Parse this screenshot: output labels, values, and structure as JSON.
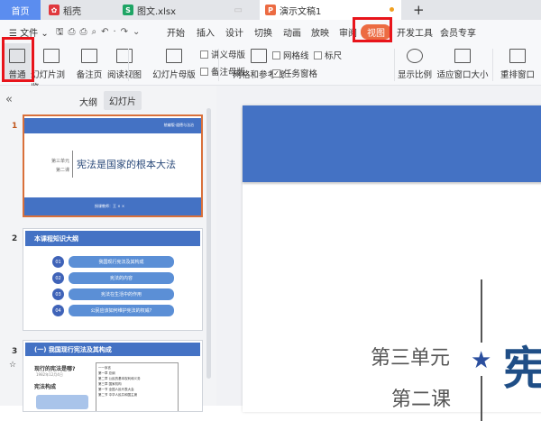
{
  "tabs": [
    {
      "label": "首页"
    },
    {
      "label": "稻壳"
    },
    {
      "label": "图文.xlsx"
    },
    {
      "label": "演示文稿1"
    }
  ],
  "new_tab": "+",
  "menu": {
    "file": "文件",
    "items": [
      "开始",
      "插入",
      "设计",
      "切换",
      "动画",
      "放映",
      "审阅",
      "视图",
      "开发工具",
      "会员专享"
    ]
  },
  "ribbon": {
    "normal": "普通",
    "slide_sorter": "幻灯片浏览",
    "notes_page": "备注页",
    "reading_view": "阅读视图",
    "slide_master": "幻灯片母版",
    "handout_master": "讲义母版",
    "notes_master": "备注母版",
    "grid_guides": "网格和参考线",
    "gridlines": "网格线",
    "ruler": "标尺",
    "task_pane": "任务窗格",
    "zoom": "显示比例",
    "fit_window": "适应窗口大小",
    "arrange": "重排窗口"
  },
  "panel": {
    "collapse": "«",
    "tab_outline": "大纲",
    "tab_slides": "幻灯片"
  },
  "slides": [
    {
      "num": "1",
      "header": "统编版·道德与法治",
      "unit": "第三单元",
      "lesson": "第二课",
      "title": "宪法是国家的根本大法",
      "teacher": "授课教师：王 × ×"
    },
    {
      "num": "2",
      "title": "本课程知识大纲",
      "items": [
        {
          "n": "01",
          "t": "我国现行宪法及其构成"
        },
        {
          "n": "02",
          "t": "宪法的内容"
        },
        {
          "n": "03",
          "t": "宪法在生活中的作用"
        },
        {
          "n": "04",
          "t": "公民应该如何维护宪法的权威?"
        }
      ]
    },
    {
      "num": "3",
      "title": "(一) 我国现行宪法及其构成",
      "q1": "现行的宪法是哪?",
      "q1sub": "1982年12月4日",
      "q2": "宪法构成",
      "box": [
        "一一序言",
        "第一章 总纲",
        "第二章 公民的基本权利和义务",
        "第三章 国家机构",
        "第一节 全国人民代表大会",
        "第二节 中华人民共和国主席"
      ]
    }
  ],
  "canvas": {
    "unit": "第三单元",
    "lesson": "第二课",
    "title_char": "宪"
  },
  "colors": {
    "accent": "#4472c4",
    "active_tab": "#ec6b42",
    "red": "#e8141b"
  }
}
